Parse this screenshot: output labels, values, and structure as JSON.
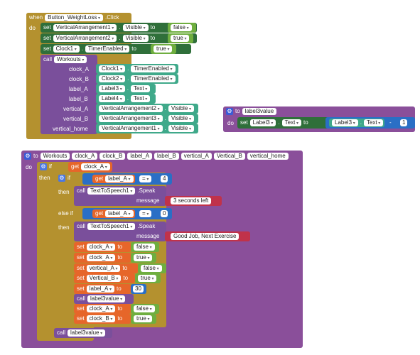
{
  "colors": {
    "event": "#b4912f",
    "set": "#2f6f3a",
    "call": "#7a4f9b",
    "green_val": "#6fae3f",
    "teal": "#3fa98a",
    "proc": "#8a4f9a",
    "if": "#b4912f",
    "get": "#e6662a",
    "math": "#2a6fc5",
    "text": "#c0324a"
  },
  "event1": {
    "when": "when",
    "button": "Button_WeightLoss",
    "click": ".Click",
    "do": "do",
    "sets": [
      {
        "comp": "VerticalArrangement1",
        "prop": "Visible",
        "to": "to",
        "val": "false"
      },
      {
        "comp": "VerticalArrangement2",
        "prop": "Visible",
        "to": "to",
        "val": "true"
      },
      {
        "comp": "Clock1",
        "prop": "TimerEnabled",
        "to": "to",
        "val": "true"
      }
    ],
    "set_label": "set",
    "call": "call",
    "proc": "Workouts",
    "args": [
      {
        "name": "clock_A",
        "comp": "Clock1",
        "prop": "TimerEnabled"
      },
      {
        "name": "clock_B",
        "comp": "Clock2",
        "prop": "TimerEnabled"
      },
      {
        "name": "label_A",
        "comp": "Label3",
        "prop": "Text"
      },
      {
        "name": "label_B",
        "comp": "Label4",
        "prop": "Text"
      },
      {
        "name": "vertical_A",
        "comp": "VerticalArrangement2",
        "prop": "Visible"
      },
      {
        "name": "vertical_B",
        "comp": "VerticalArrangement3",
        "prop": "Visible"
      },
      {
        "name": "vertical_home",
        "comp": "VerticalArrangement1",
        "prop": "Visible"
      }
    ]
  },
  "proc_label": {
    "to": "to",
    "name": "label3value",
    "do": "do",
    "set": "set",
    "comp": "Label3",
    "prop": "Text",
    "to2": "to",
    "comp2": "Label3",
    "prop2": "Text",
    "op": "-",
    "num": "1"
  },
  "proc_workouts": {
    "to": "to",
    "name": "Workouts",
    "params": [
      "clock_A",
      "clock_B",
      "label_A",
      "label_B",
      "vertical_A",
      "Vertical_B",
      "vertical_home"
    ],
    "do": "do",
    "if": "if",
    "get": "get",
    "cond_var": "clock_A",
    "then": "then",
    "else_if": "else if",
    "eq": "=",
    "inner_if_var": "label_A",
    "num4": "4",
    "num0": "0",
    "call": "call",
    "tts": "TextToSpeech1",
    "speak": ".Speak",
    "message": "message",
    "msg1": "3 seconds left",
    "msg2": "Good Job, Next Exercise",
    "set": "set",
    "to_kw": "to",
    "sets": [
      {
        "var": "clock_A",
        "val": "false"
      },
      {
        "var": "clock_A",
        "val": "true"
      },
      {
        "var": "vertical_A",
        "val": "false"
      },
      {
        "var": "Vertical_B",
        "val": "true"
      },
      {
        "var": "label_A",
        "val": "30"
      }
    ],
    "call_label3": "label3value",
    "sets2": [
      {
        "var": "clock_A",
        "val": "false"
      },
      {
        "var": "clock_B",
        "val": "true"
      }
    ],
    "final_call": "label3value"
  }
}
